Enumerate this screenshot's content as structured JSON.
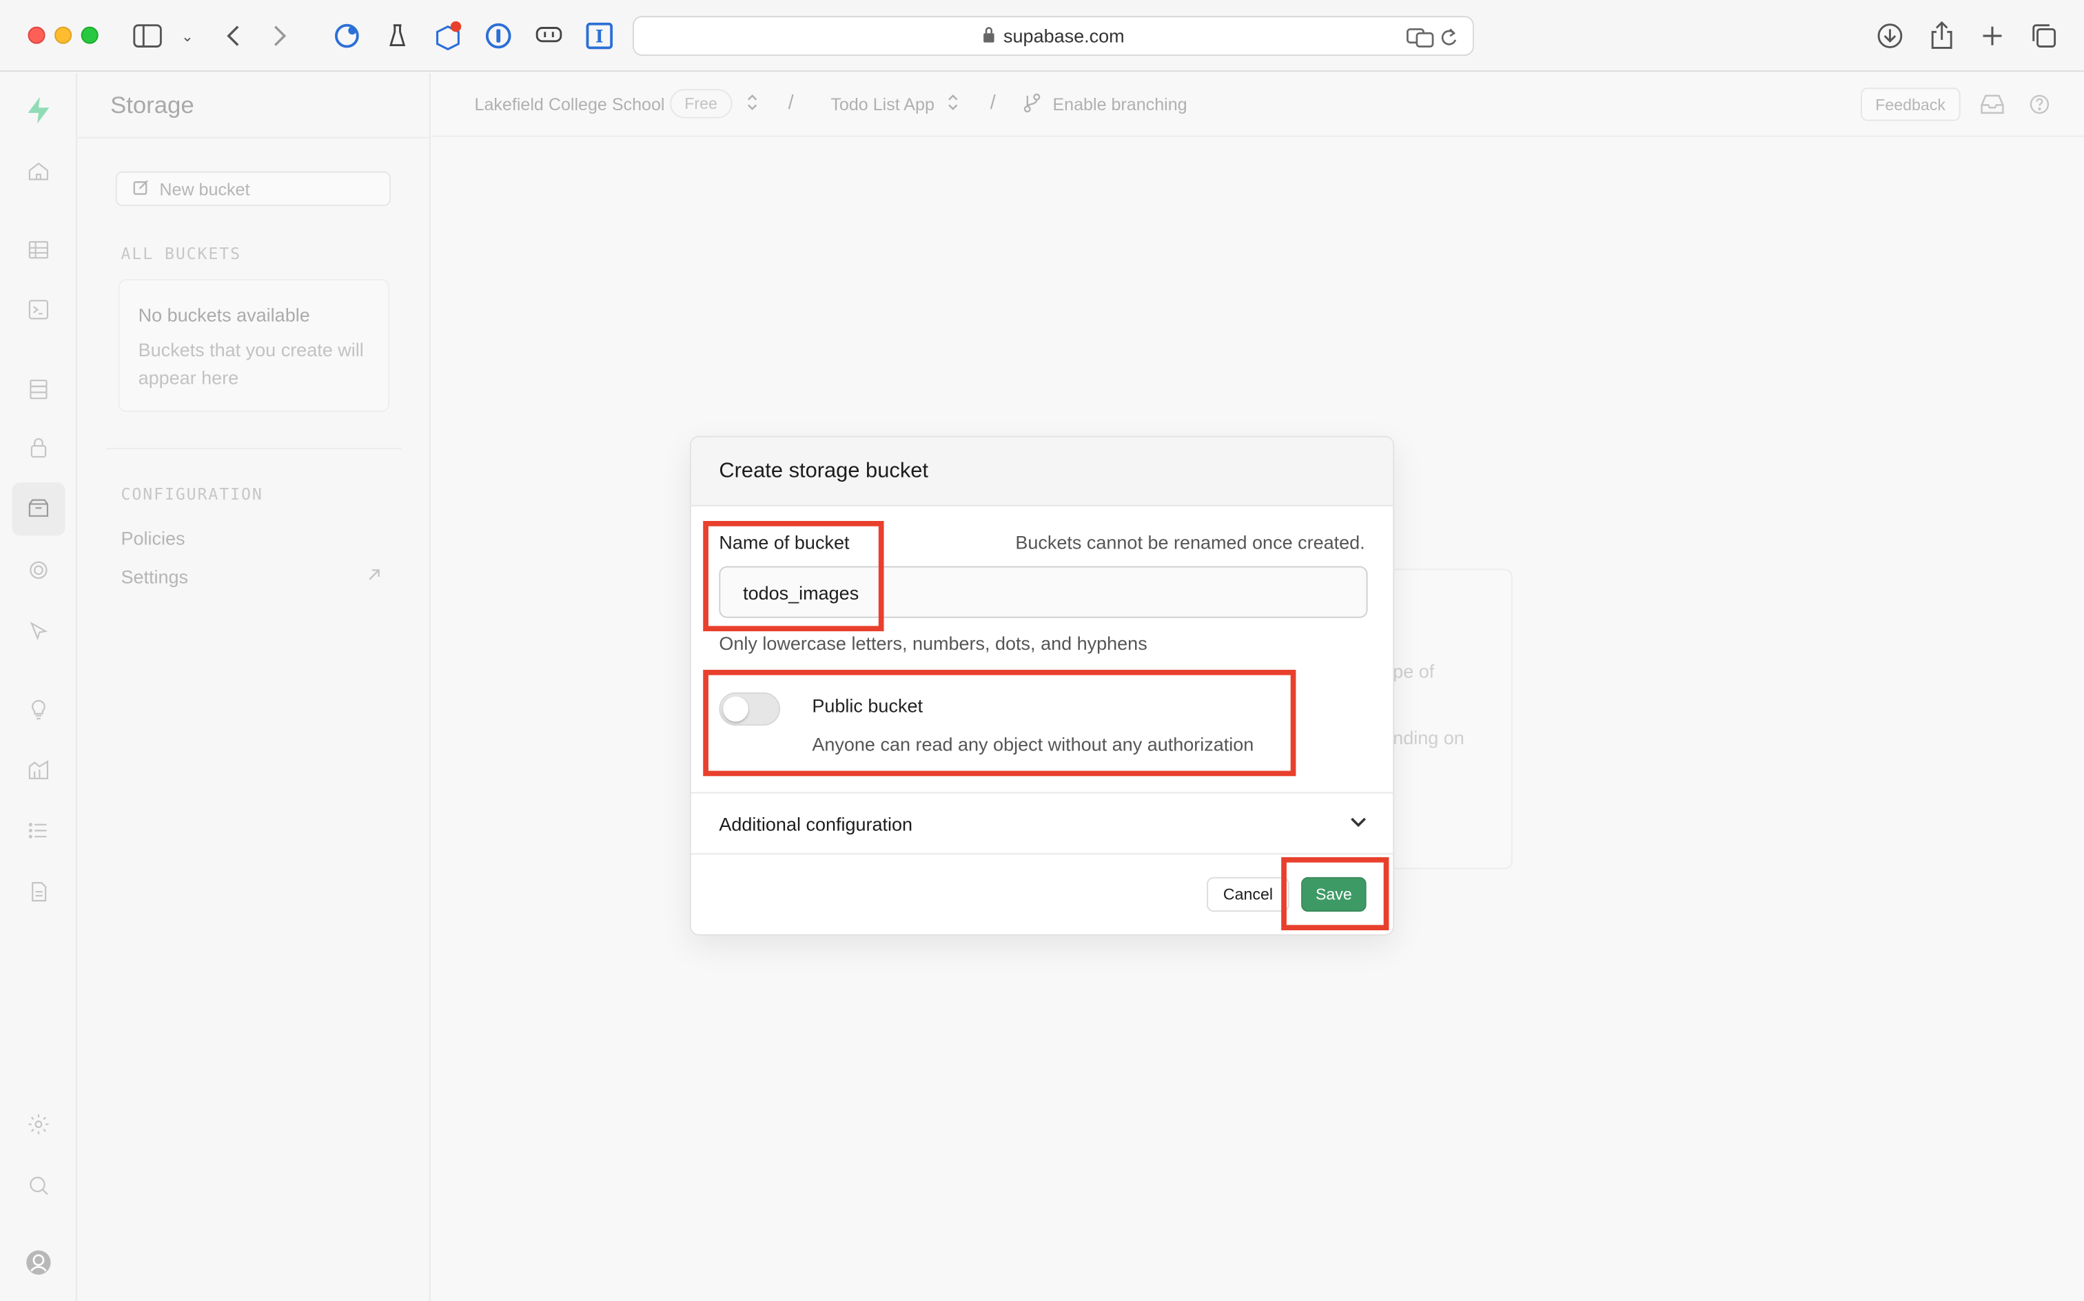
{
  "browser": {
    "url": "supabase.com"
  },
  "sidebar": {
    "title": "Storage",
    "new_bucket_label": "New bucket",
    "all_buckets_heading": "ALL BUCKETS",
    "empty_title": "No buckets available",
    "empty_desc": "Buckets that you create will appear here",
    "configuration_heading": "CONFIGURATION",
    "policies_label": "Policies",
    "settings_label": "Settings"
  },
  "topbar": {
    "org_name": "Lakefield College School",
    "plan": "Free",
    "project_name": "Todo List App",
    "branching_label": "Enable branching",
    "feedback_label": "Feedback"
  },
  "background_card": {
    "fragment_1": "pe of",
    "fragment_2": "nding on"
  },
  "modal": {
    "title": "Create storage bucket",
    "name_label": "Name of bucket",
    "rename_hint": "Buckets cannot be renamed once created.",
    "name_value": "todos_images",
    "name_help": "Only lowercase letters, numbers, dots, and hyphens",
    "public_label": "Public bucket",
    "public_desc": "Anyone can read any object without any authorization",
    "public_enabled": false,
    "additional_config_label": "Additional configuration",
    "cancel_label": "Cancel",
    "save_label": "Save"
  },
  "colors": {
    "highlight": "#e8402c",
    "save_button": "#3e9a65",
    "brand": "#3ecf8e"
  }
}
